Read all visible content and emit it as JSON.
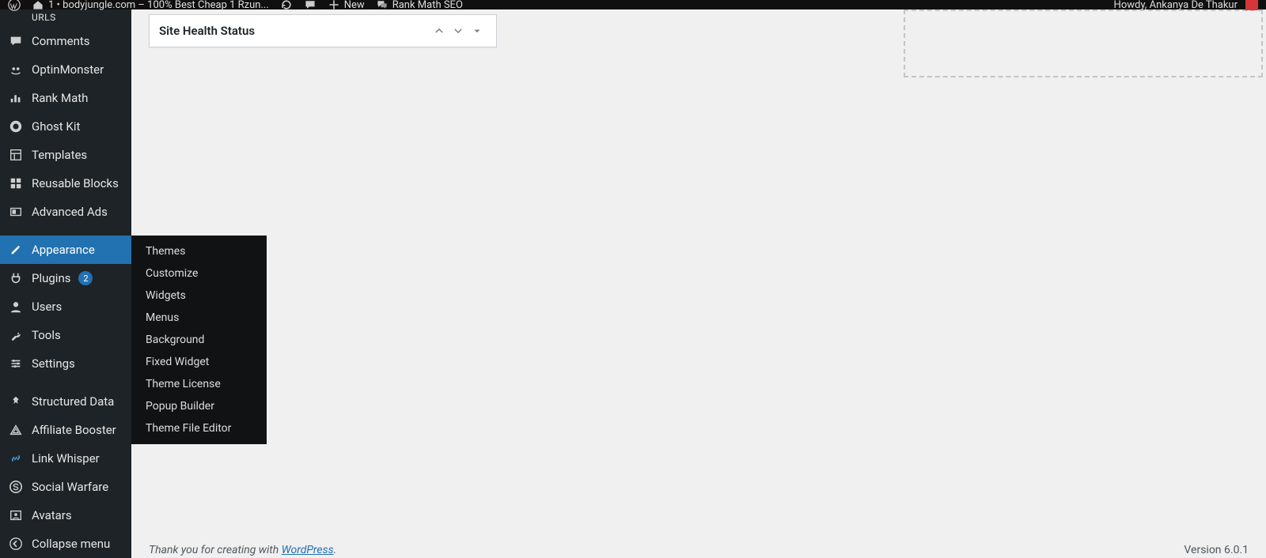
{
  "topbar": {
    "site_name": "1 • bodyjungle.com – 100% Best Cheap 1 Rzun...",
    "new_label": "New",
    "rankmath_label": "Rank Math SEO",
    "greeting": "Howdy, Ankanya De Thakur"
  },
  "sidebar": {
    "top_cut_label": "URLs",
    "items": [
      {
        "label": "Comments",
        "icon": "comment"
      },
      {
        "label": "OptinMonster",
        "icon": "monster"
      },
      {
        "label": "Rank Math",
        "icon": "chart"
      },
      {
        "label": "Ghost Kit",
        "icon": "circle-g"
      },
      {
        "label": "Templates",
        "icon": "layout"
      },
      {
        "label": "Reusable Blocks",
        "icon": "blocks"
      },
      {
        "label": "Advanced Ads",
        "icon": "ads"
      },
      {
        "label": "Appearance",
        "icon": "brush",
        "active": true
      },
      {
        "label": "Plugins",
        "icon": "plug",
        "badge": "2"
      },
      {
        "label": "Users",
        "icon": "user"
      },
      {
        "label": "Tools",
        "icon": "wrench"
      },
      {
        "label": "Settings",
        "icon": "sliders"
      },
      {
        "label": "Structured Data",
        "icon": "pin"
      },
      {
        "label": "Affiliate Booster",
        "icon": "triangle"
      },
      {
        "label": "Link Whisper",
        "icon": "link"
      },
      {
        "label": "Social Warfare",
        "icon": "circle-s"
      },
      {
        "label": "Avatars",
        "icon": "avatar"
      }
    ],
    "collapse_label": "Collapse menu"
  },
  "flyout": {
    "items": [
      "Themes",
      "Customize",
      "Widgets",
      "Menus",
      "Background",
      "Fixed Widget",
      "Theme License",
      "Popup Builder",
      "Theme File Editor"
    ]
  },
  "widget": {
    "title": "Site Health Status"
  },
  "footer": {
    "thanks_prefix": "Thank you for creating with ",
    "link_text": "WordPress",
    "thanks_suffix": ".",
    "version": "Version 6.0.1"
  }
}
